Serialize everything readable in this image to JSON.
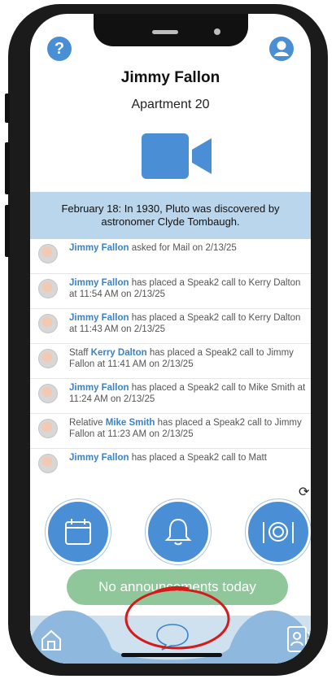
{
  "header": {
    "resident_name": "Jimmy Fallon",
    "apartment": "Apartment 20",
    "help_icon": "question-circle-icon",
    "profile_icon": "user-circle-icon",
    "video_icon": "video-camera-icon"
  },
  "fact_banner": "February 18: In 1930, Pluto was discovered by astronomer Clyde Tombaugh.",
  "feed": [
    {
      "pre": "",
      "name": "Jimmy Fallon",
      "post": " asked for Mail on 2/13/25"
    },
    {
      "pre": "",
      "name": "Jimmy Fallon",
      "post": " has placed a Speak2 call to Kerry Dalton at 11:54 AM on 2/13/25"
    },
    {
      "pre": "",
      "name": "Jimmy Fallon",
      "post": " has placed a Speak2 call to Kerry Dalton at 11:43 AM on 2/13/25"
    },
    {
      "pre": "Staff ",
      "name": "Kerry Dalton",
      "post": " has placed a Speak2 call to Jimmy Fallon at 11:41 AM on 2/13/25"
    },
    {
      "pre": "",
      "name": "Jimmy Fallon",
      "post": " has placed a Speak2 call to Mike Smith at 11:24 AM on 2/13/25"
    },
    {
      "pre": "Relative ",
      "name": "Mike Smith",
      "post": " has placed a Speak2 call to Jimmy Fallon at 11:23 AM on 2/13/25"
    },
    {
      "pre": "",
      "name": "Jimmy Fallon",
      "post": " has placed a Speak2 call to Matt"
    }
  ],
  "quick_actions": {
    "calendar_icon": "calendar-icon",
    "bell_icon": "bell-icon",
    "dining_icon": "plate-cutlery-icon",
    "refresh_icon": "refresh-icon"
  },
  "announcement": "No announcements today",
  "tabbar": {
    "home_icon": "home-icon",
    "chat_icon": "chat-bubble-icon",
    "contacts_icon": "contacts-icon"
  },
  "colors": {
    "accent": "#4a8fd6",
    "banner": "#b9d6ec",
    "announcement": "#8fc79a",
    "annotation": "#d51a1a"
  }
}
